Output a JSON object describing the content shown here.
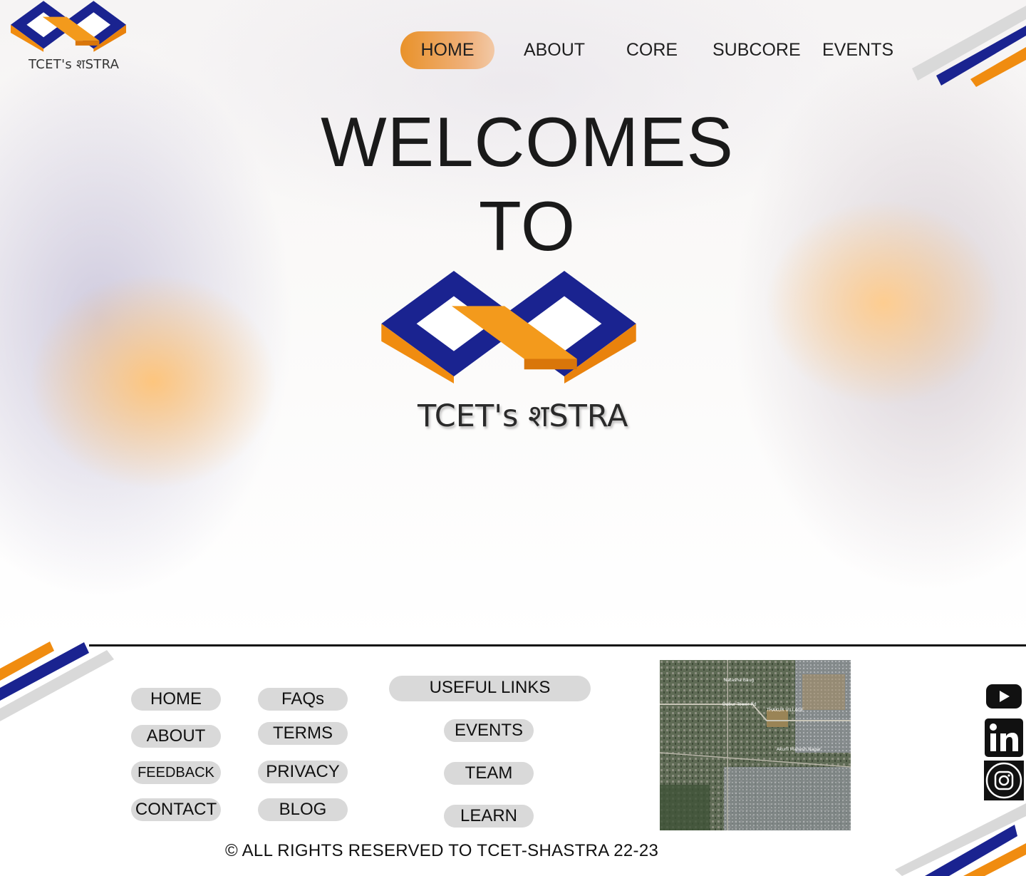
{
  "brand": {
    "name": "TCET's शSTRA",
    "colors": {
      "blue": "#1a2390",
      "orange": "#f08c10",
      "accent_gray": "#d9d9d9"
    }
  },
  "nav": {
    "items": [
      {
        "label": "HOME",
        "active": true
      },
      {
        "label": "ABOUT"
      },
      {
        "label": "CORE"
      },
      {
        "label": "SUBCORE"
      },
      {
        "label": "EVENTS"
      }
    ]
  },
  "hero": {
    "line1": "WELCOMES",
    "line2": "TO",
    "brand_text": "TCET's शSTRA"
  },
  "footer": {
    "col1": [
      "HOME",
      "ABOUT",
      "FEEDBACK",
      "CONTACT"
    ],
    "col2": [
      "FAQs",
      "TERMS",
      "PRIVACY",
      "BLOG"
    ],
    "useful_links": {
      "title": "USEFUL LINKS",
      "items": [
        "EVENTS",
        "TEAM",
        "LEARN"
      ]
    },
    "map_labels": [
      "Natasha Baug",
      "Dabur Tower Rd",
      "THAKUR VILLAGE",
      "Akurli Mahesh Nagar"
    ],
    "social": [
      {
        "icon": "youtube-icon",
        "label": "YouTube"
      },
      {
        "icon": "linkedin-icon",
        "label": "LinkedIn"
      },
      {
        "icon": "instagram-icon",
        "label": "Instagram"
      }
    ],
    "copyright": "© ALL RIGHTS RESERVED TO TCET-SHASTRA 22-23"
  }
}
